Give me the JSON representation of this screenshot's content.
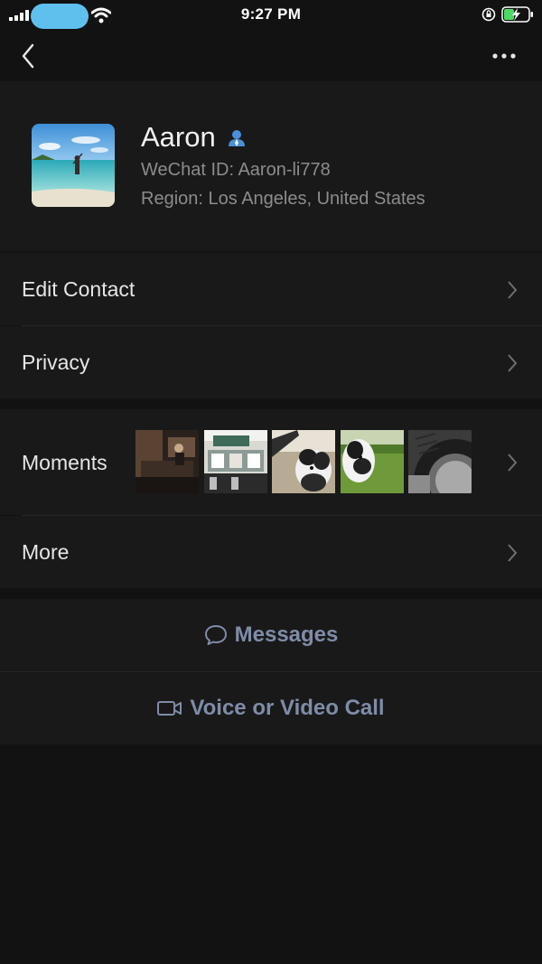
{
  "status_bar": {
    "time": "9:27 PM"
  },
  "profile": {
    "name": "Aaron",
    "wechat_id": "WeChat ID: Aaron-li778",
    "region": "Region: Los Angeles, United States"
  },
  "menu": {
    "edit_contact": "Edit Contact",
    "privacy": "Privacy",
    "moments": "Moments",
    "more": "More"
  },
  "actions": {
    "messages": "Messages",
    "call": "Voice or Video Call"
  },
  "colors": {
    "background": "#121212",
    "row_background": "#191919",
    "action_text": "#7f8ca8",
    "gender_icon": "#4a8fd8"
  }
}
